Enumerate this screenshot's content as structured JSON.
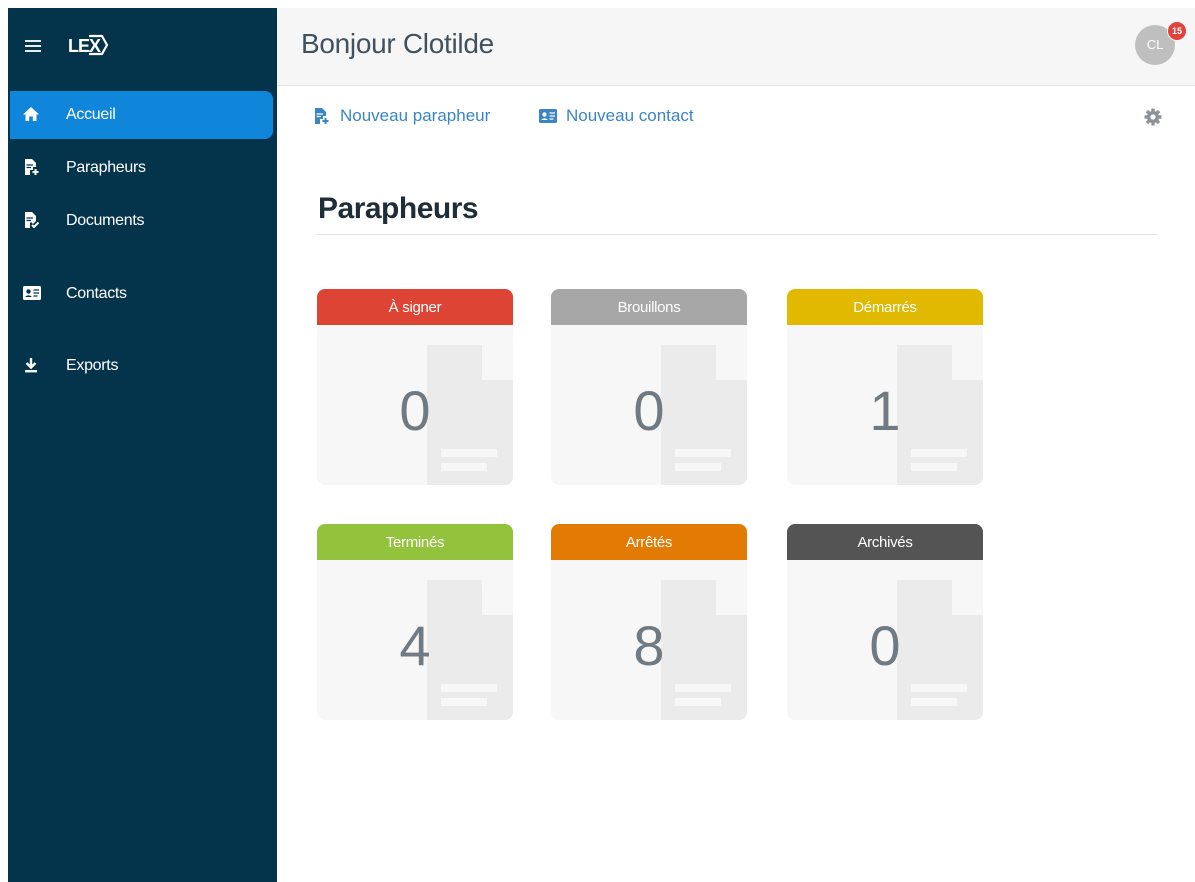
{
  "sidebar": {
    "logo": "LEX",
    "items": [
      {
        "label": "Accueil",
        "icon": "home-icon",
        "active": true
      },
      {
        "label": "Parapheurs",
        "icon": "file-add-icon",
        "active": false
      },
      {
        "label": "Documents",
        "icon": "file-check-icon",
        "active": false
      },
      {
        "label": "Contacts",
        "icon": "contact-card-icon",
        "active": false
      },
      {
        "label": "Exports",
        "icon": "download-icon",
        "active": false
      }
    ]
  },
  "header": {
    "greeting": "Bonjour Clotilde",
    "avatar_initials": "CL",
    "notification_count": "15"
  },
  "toolbar": {
    "new_parapheur": "Nouveau parapheur",
    "new_contact": "Nouveau contact"
  },
  "section": {
    "title": "Parapheurs"
  },
  "cards": [
    {
      "label": "À signer",
      "count": "0",
      "color": "#de4434"
    },
    {
      "label": "Brouillons",
      "count": "0",
      "color": "#a7a7a7"
    },
    {
      "label": "Démarrés",
      "count": "1",
      "color": "#e0b900"
    },
    {
      "label": "Terminés",
      "count": "4",
      "color": "#93c23c"
    },
    {
      "label": "Arrêtés",
      "count": "8",
      "color": "#e37a04"
    },
    {
      "label": "Archivés",
      "count": "0",
      "color": "#545454"
    }
  ],
  "colors": {
    "sidebar_bg": "#04334c",
    "active_nav": "#0f86d9",
    "link": "#3a86c5"
  }
}
